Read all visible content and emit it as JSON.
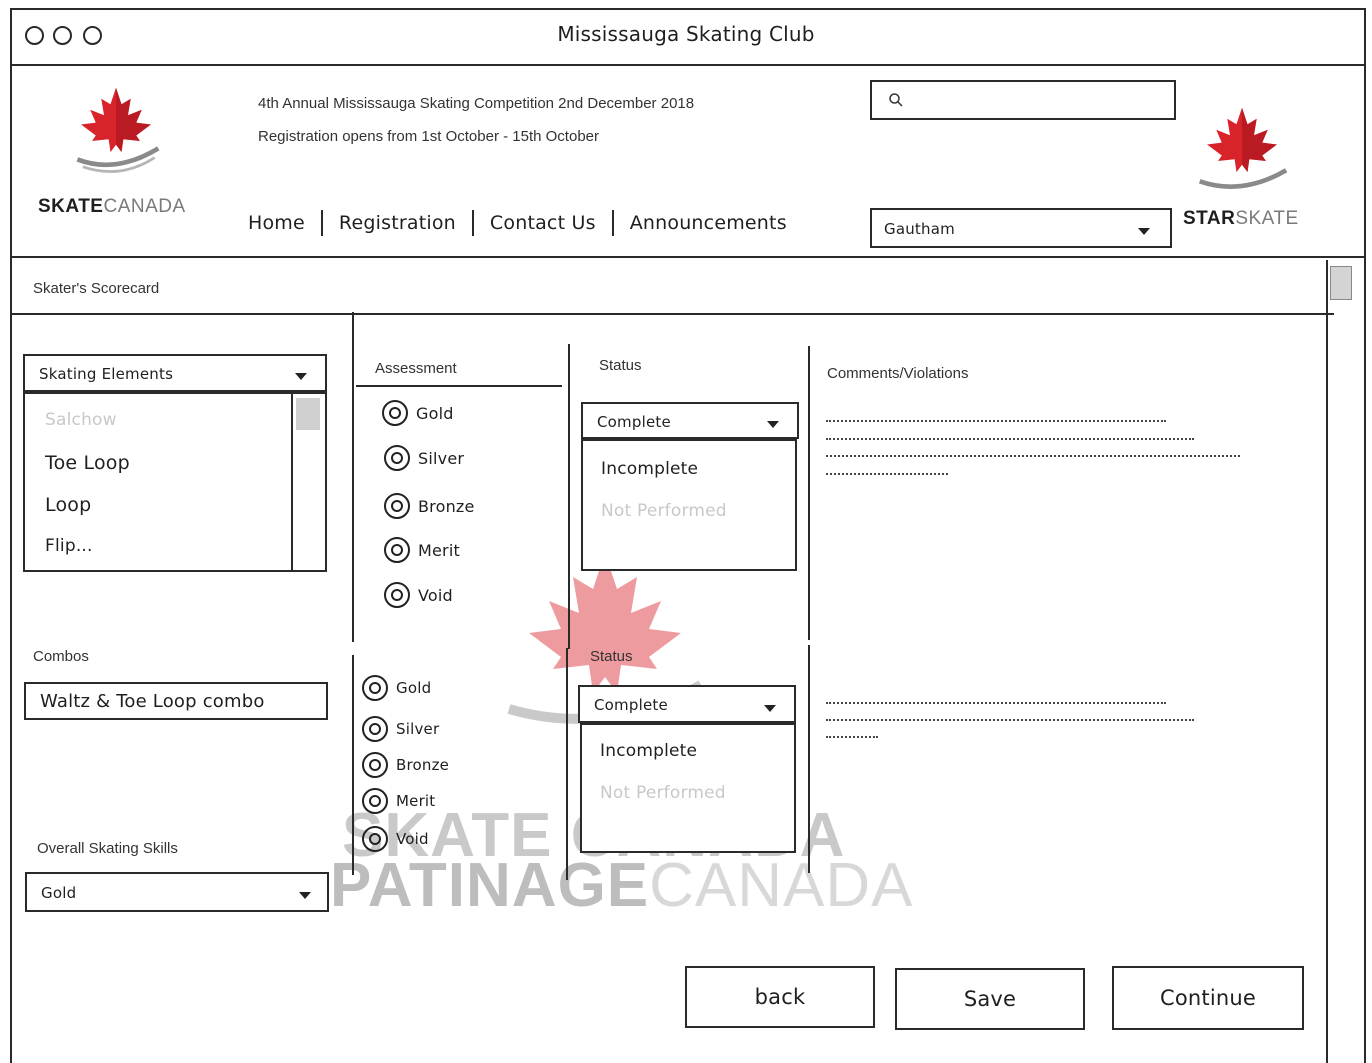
{
  "window": {
    "title": "Mississauga Skating Club"
  },
  "header": {
    "left_logo": {
      "bold": "SKATE",
      "light": "CANADA"
    },
    "right_logo": {
      "bold": "STAR",
      "light": "SKATE"
    },
    "announcement_line1": "4th Annual Mississauga Skating Competition 2nd December 2018",
    "announcement_line2": "Registration opens from 1st October - 15th October",
    "nav": [
      "Home",
      "Registration",
      "Contact Us",
      "Announcements"
    ],
    "search": {
      "value": "",
      "icon": "search-icon"
    },
    "user_select": {
      "value": "Gautham"
    }
  },
  "page": {
    "title": "Skater's Scorecard"
  },
  "elements": {
    "select_label": "Skating Elements",
    "options": [
      "Salchow",
      "Toe Loop",
      "Loop",
      "Flip..."
    ]
  },
  "assessment": {
    "header": "Assessment",
    "options": [
      "Gold",
      "Silver",
      "Bronze",
      "Merit",
      "Void"
    ],
    "combo_options": [
      "Gold",
      "Silver",
      "Bronze",
      "Merit",
      "Void"
    ]
  },
  "status": {
    "header": "Status",
    "selected": "Complete",
    "options": [
      "Incomplete",
      "Not Performed"
    ],
    "combo_header": "Status",
    "combo_selected": "Complete",
    "combo_options": [
      "Incomplete",
      "Not Performed"
    ]
  },
  "comments": {
    "header": "Comments/Violations"
  },
  "combos": {
    "label": "Combos",
    "value": "Waltz & Toe Loop combo"
  },
  "overall": {
    "label": "Overall Skating Skills",
    "value": "Gold"
  },
  "watermark": {
    "line1": "SKATE CANADA",
    "line2_bold": "PATINAGE",
    "line2_light": "CANADA"
  },
  "buttons": {
    "back": "back",
    "save": "Save",
    "continue": "Continue"
  },
  "colors": {
    "leaf_red": "#d8232a",
    "leaf_dark": "#a3161c",
    "swoosh": "#8a8a8a"
  }
}
